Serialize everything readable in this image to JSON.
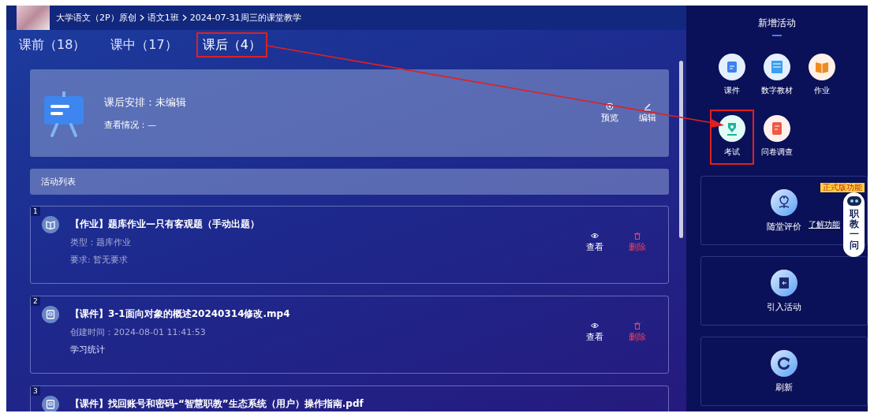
{
  "breadcrumb": {
    "path": [
      "大学语文（2P）原创",
      "语文1班",
      "2024-07-31周三的课堂教学"
    ]
  },
  "tabs": [
    {
      "label": "课前（18）",
      "selected": false,
      "highlighted": false
    },
    {
      "label": "课中（17）",
      "selected": false,
      "highlighted": false
    },
    {
      "label": "课后（4）",
      "selected": true,
      "highlighted": true
    }
  ],
  "summary": {
    "title": "课后安排：未编辑",
    "status": "查看情况：—",
    "actions": [
      {
        "kind": "preview",
        "label": "预览"
      },
      {
        "kind": "edit",
        "label": "编辑"
      }
    ]
  },
  "activity_list": {
    "title": "活动列表",
    "items": [
      {
        "number": "1",
        "kind": "homework",
        "title": "【作业】题库作业—只有客观题（手动出题）",
        "details": [
          {
            "kind": "meta",
            "text": "类型：题库作业"
          },
          {
            "kind": "meta",
            "text": "要求: 暂无要求"
          }
        ],
        "actions": [
          {
            "kind": "view",
            "label": "查看"
          },
          {
            "kind": "delete",
            "label": "删除"
          }
        ]
      },
      {
        "number": "2",
        "kind": "courseware",
        "title": "【课件】3-1面向对象的概述20240314修改.mp4",
        "details": [
          {
            "kind": "meta",
            "text": "创建时间：2024-08-01 11:41:53"
          },
          {
            "kind": "link",
            "text": "学习统计"
          }
        ],
        "actions": [
          {
            "kind": "view",
            "label": "查看"
          },
          {
            "kind": "delete",
            "label": "删除"
          }
        ]
      },
      {
        "number": "3",
        "kind": "courseware",
        "title": "【课件】找回账号和密码-“智慧职教”生态系统（用户）操作指南.pdf"
      }
    ]
  },
  "add_activity": {
    "title": "新增活动",
    "items": [
      {
        "kind": "courseware",
        "label": "课件",
        "highlighted": false
      },
      {
        "kind": "textbook",
        "label": "数字教材",
        "highlighted": false
      },
      {
        "kind": "homework",
        "label": "作业",
        "highlighted": false
      },
      {
        "kind": "exam",
        "label": "考试",
        "highlighted": true
      },
      {
        "kind": "survey",
        "label": "问卷调查",
        "highlighted": false
      }
    ]
  },
  "tools": [
    {
      "kind": "evaluate",
      "label": "随堂评价",
      "link": "了解功能"
    },
    {
      "kind": "import",
      "label": "引入活动"
    },
    {
      "kind": "refresh",
      "label": "刷新"
    }
  ],
  "assistant": {
    "badge": "正式版功能",
    "label": "职教一问"
  }
}
